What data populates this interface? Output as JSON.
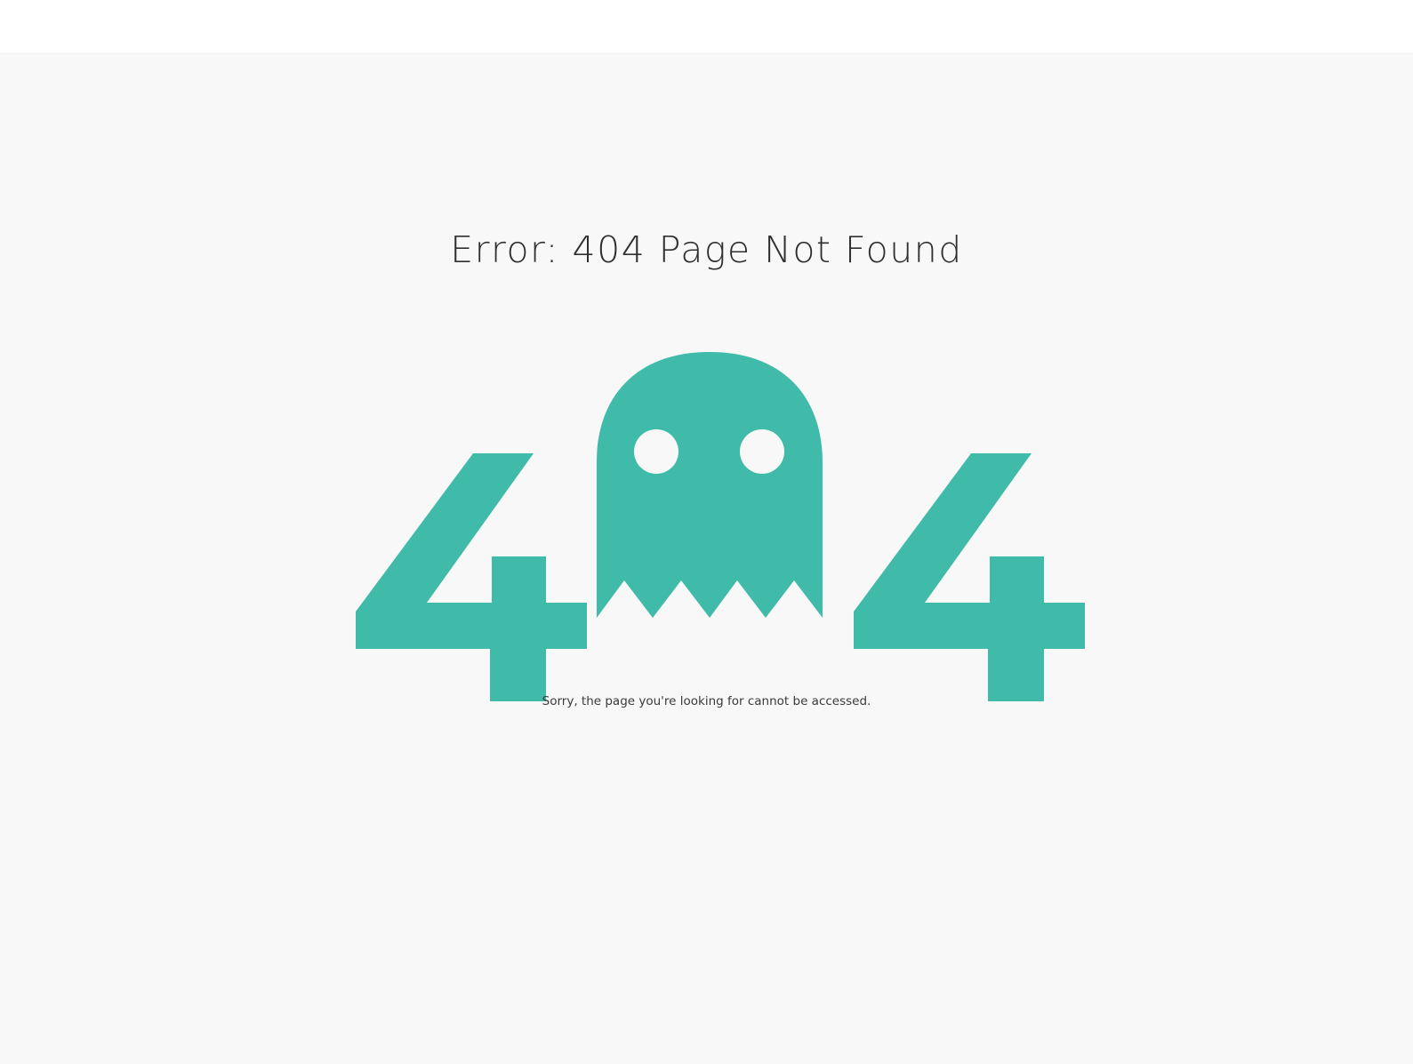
{
  "error_title": "Error: 404 Page Not Found",
  "message": "Sorry, the page you're looking for cannot be accessed.",
  "colors": {
    "accent": "#41bba9",
    "background": "#f8f8f8",
    "header": "#ffffff",
    "title_text": "#2f2f2f"
  },
  "icons": {
    "left_digit": "digit-four",
    "center": "ghost-icon",
    "right_digit": "digit-four"
  }
}
